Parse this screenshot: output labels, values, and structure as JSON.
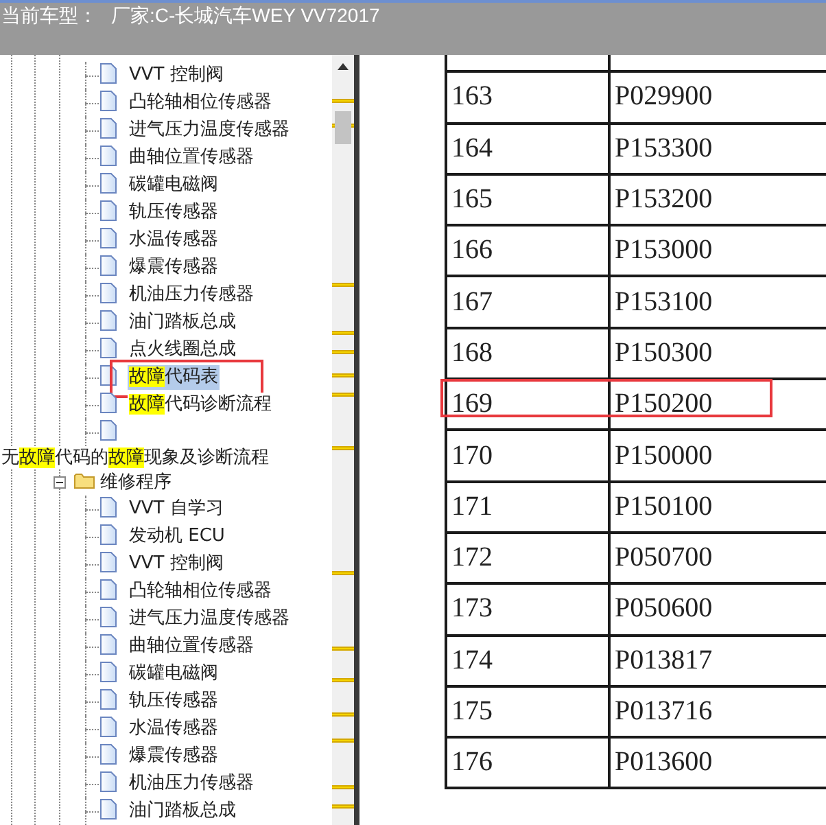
{
  "header": {
    "label": "当前车型：",
    "value": "厂家:C-长城汽车WEY VV72017"
  },
  "tree": [
    {
      "kind": "doc",
      "parts": [
        {
          "text": "VVT 控制阀",
          "highlighted": false
        }
      ],
      "selected": false,
      "annotated": false
    },
    {
      "kind": "doc",
      "parts": [
        {
          "text": "凸轮轴相位传感器",
          "highlighted": false
        }
      ],
      "selected": false,
      "annotated": false
    },
    {
      "kind": "doc",
      "parts": [
        {
          "text": "进气压力温度传感器",
          "highlighted": false
        }
      ],
      "selected": false,
      "annotated": false
    },
    {
      "kind": "doc",
      "parts": [
        {
          "text": "曲轴位置传感器",
          "highlighted": false
        }
      ],
      "selected": false,
      "annotated": false
    },
    {
      "kind": "doc",
      "parts": [
        {
          "text": "碳罐电磁阀",
          "highlighted": false
        }
      ],
      "selected": false,
      "annotated": false
    },
    {
      "kind": "doc",
      "parts": [
        {
          "text": "轨压传感器",
          "highlighted": false
        }
      ],
      "selected": false,
      "annotated": false
    },
    {
      "kind": "doc",
      "parts": [
        {
          "text": "水温传感器",
          "highlighted": false
        }
      ],
      "selected": false,
      "annotated": false
    },
    {
      "kind": "doc",
      "parts": [
        {
          "text": "爆震传感器",
          "highlighted": false
        }
      ],
      "selected": false,
      "annotated": false
    },
    {
      "kind": "doc",
      "parts": [
        {
          "text": "机油压力传感器",
          "highlighted": false
        }
      ],
      "selected": false,
      "annotated": false
    },
    {
      "kind": "doc",
      "parts": [
        {
          "text": "油门踏板总成",
          "highlighted": false
        }
      ],
      "selected": false,
      "annotated": false
    },
    {
      "kind": "doc",
      "parts": [
        {
          "text": "点火线圈总成",
          "highlighted": false
        }
      ],
      "selected": false,
      "annotated": false
    },
    {
      "kind": "doc",
      "parts": [
        {
          "text": "故障",
          "highlighted": true
        },
        {
          "text": "代码表",
          "highlighted": false
        }
      ],
      "selected": true,
      "annotated": true
    },
    {
      "kind": "doc",
      "parts": [
        {
          "text": "故障",
          "highlighted": true
        },
        {
          "text": "代码诊断流程",
          "highlighted": false
        }
      ],
      "selected": false,
      "annotated": false
    },
    {
      "kind": "doc",
      "selected": false,
      "annotated": false
    },
    {
      "kind": "heading",
      "parts": [
        {
          "text": "无",
          "highlighted": false
        },
        {
          "text": "故障",
          "highlighted": true
        },
        {
          "text": "代码的",
          "highlighted": false
        },
        {
          "text": "故障",
          "highlighted": true
        },
        {
          "text": "现象及诊断流程",
          "highlighted": false
        }
      ],
      "selected": false,
      "annotated": false
    },
    {
      "kind": "folder",
      "expanded": true,
      "parts": [
        {
          "text": "维修程序",
          "highlighted": false
        }
      ],
      "selected": false,
      "annotated": false,
      "children": [
        {
          "kind": "doc",
          "parts": [
            {
              "text": "VVT 自学习",
              "highlighted": false
            }
          ],
          "selected": false,
          "annotated": false
        },
        {
          "kind": "doc",
          "parts": [
            {
              "text": "发动机 ECU",
              "highlighted": false
            }
          ],
          "selected": false,
          "annotated": false
        },
        {
          "kind": "doc",
          "parts": [
            {
              "text": "VVT 控制阀",
              "highlighted": false
            }
          ],
          "selected": false,
          "annotated": false
        },
        {
          "kind": "doc",
          "parts": [
            {
              "text": "凸轮轴相位传感器",
              "highlighted": false
            }
          ],
          "selected": false,
          "annotated": false
        },
        {
          "kind": "doc",
          "parts": [
            {
              "text": "进气压力温度传感器",
              "highlighted": false
            }
          ],
          "selected": false,
          "annotated": false
        },
        {
          "kind": "doc",
          "parts": [
            {
              "text": "曲轴位置传感器",
              "highlighted": false
            }
          ],
          "selected": false,
          "annotated": false
        },
        {
          "kind": "doc",
          "parts": [
            {
              "text": "碳罐电磁阀",
              "highlighted": false
            }
          ],
          "selected": false,
          "annotated": false
        },
        {
          "kind": "doc",
          "parts": [
            {
              "text": "轨压传感器",
              "highlighted": false
            }
          ],
          "selected": false,
          "annotated": false
        },
        {
          "kind": "doc",
          "parts": [
            {
              "text": "水温传感器",
              "highlighted": false
            }
          ],
          "selected": false,
          "annotated": false
        },
        {
          "kind": "doc",
          "parts": [
            {
              "text": "爆震传感器",
              "highlighted": false
            }
          ],
          "selected": false,
          "annotated": false
        },
        {
          "kind": "doc",
          "parts": [
            {
              "text": "机油压力传感器",
              "highlighted": false
            }
          ],
          "selected": false,
          "annotated": false
        },
        {
          "kind": "doc",
          "parts": [
            {
              "text": "油门踏板总成",
              "highlighted": false
            }
          ],
          "selected": false,
          "annotated": false
        }
      ]
    }
  ],
  "table": {
    "rows": [
      {
        "number": "163",
        "code": "P029900",
        "annotated": false
      },
      {
        "number": "164",
        "code": "P153300",
        "annotated": false
      },
      {
        "number": "165",
        "code": "P153200",
        "annotated": false
      },
      {
        "number": "166",
        "code": "P153000",
        "annotated": false
      },
      {
        "number": "167",
        "code": "P153100",
        "annotated": false
      },
      {
        "number": "168",
        "code": "P150300",
        "annotated": false
      },
      {
        "number": "169",
        "code": "P150200",
        "annotated": true
      },
      {
        "number": "170",
        "code": "P150000",
        "annotated": false
      },
      {
        "number": "171",
        "code": "P150100",
        "annotated": false
      },
      {
        "number": "172",
        "code": "P050700",
        "annotated": false
      },
      {
        "number": "173",
        "code": "P050600",
        "annotated": false
      },
      {
        "number": "174",
        "code": "P013817",
        "annotated": false
      },
      {
        "number": "175",
        "code": "P013716",
        "annotated": false
      },
      {
        "number": "176",
        "code": "P013600",
        "annotated": false
      }
    ]
  }
}
